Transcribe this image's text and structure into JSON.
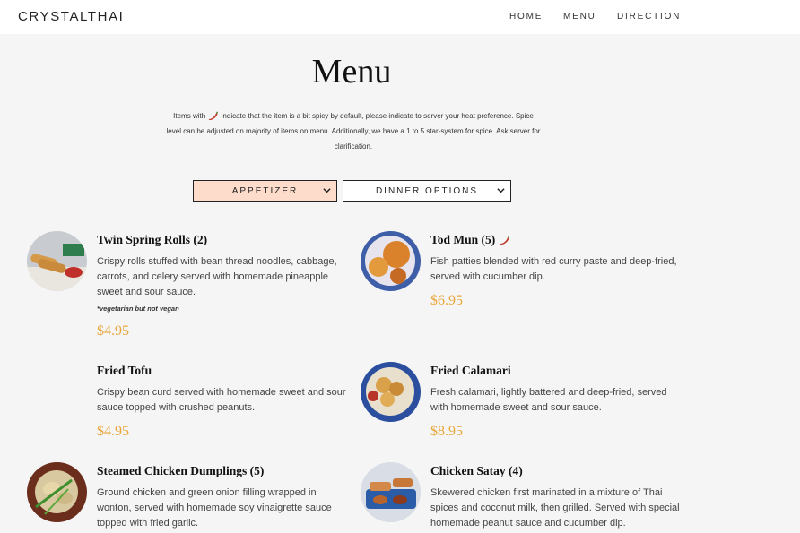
{
  "header": {
    "brand": "CRYSTALTHAI",
    "nav": [
      {
        "label": "HOME"
      },
      {
        "label": "MENU"
      },
      {
        "label": "DIRECTION"
      }
    ]
  },
  "page": {
    "title": "Menu",
    "intro_before": "Items with",
    "intro_after": "indicate that the item is a bit spicy by default, please indicate to server your heat preference. Spice level can be adjusted on majority of items on menu. Additionally, we have a 1 to 5 star-system for spice. Ask server for clarification."
  },
  "filters": {
    "category": {
      "selected": "APPETIZER",
      "bg": "#fddccb"
    },
    "options": {
      "selected": "DINNER OPTIONS",
      "bg": "#ffffff"
    }
  },
  "items": [
    {
      "name": "Twin Spring Rolls (2)",
      "spicy": false,
      "description": "Crispy rolls stuffed with bean thread noodles, cabbage, carrots, and celery served with homemade pineapple sweet and sour sauce.",
      "note": "*vegetarian but not vegan",
      "price": "$4.95"
    },
    {
      "name": "Tod Mun (5)",
      "spicy": true,
      "description": "Fish patties blended with red curry paste and deep-fried, served with cucumber dip.",
      "price": "$6.95"
    },
    {
      "name": "Fried Tofu",
      "spicy": false,
      "description": "Crispy bean curd served with homemade sweet and sour sauce topped with crushed peanuts.",
      "price": "$4.95"
    },
    {
      "name": "Fried Calamari",
      "spicy": false,
      "description": "Fresh calamari, lightly battered and deep-fried, served with homemade sweet and sour sauce.",
      "price": "$8.95"
    },
    {
      "name": "Steamed Chicken Dumplings (5)",
      "spicy": false,
      "description": "Ground chicken and green onion filling wrapped in wonton, served with homemade soy vinaigrette sauce topped with fried garlic."
    },
    {
      "name": "Chicken Satay (4)",
      "spicy": false,
      "description": "Skewered chicken first marinated in a mixture of Thai spices and coconut milk, then grilled. Served with special homemade peanut sauce and cucumber dip."
    }
  ],
  "colors": {
    "price": "#e9a63b",
    "chili": "#c0392b"
  }
}
